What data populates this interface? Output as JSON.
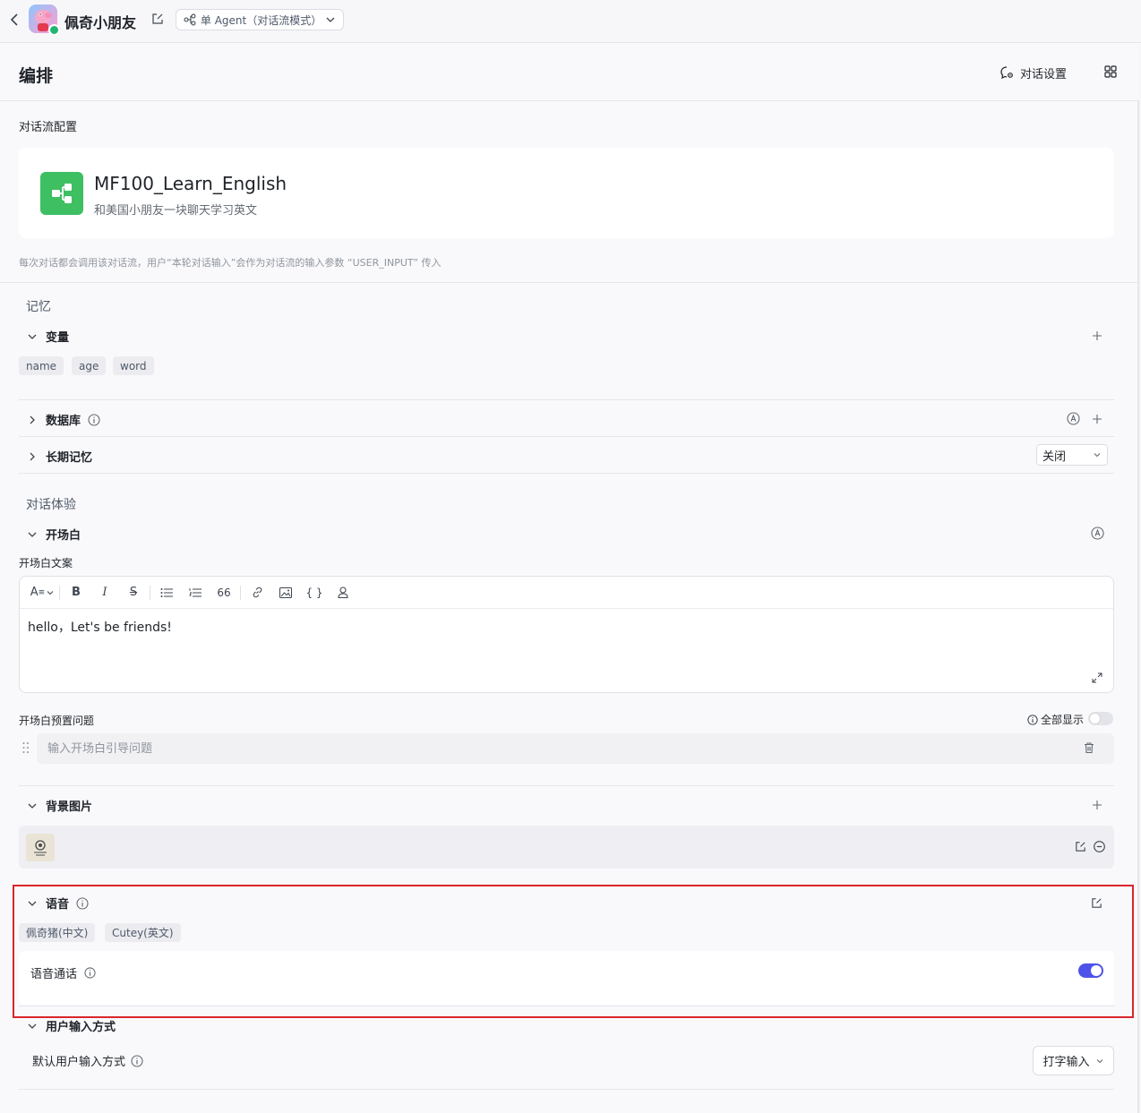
{
  "topbar": {
    "bot_name": "佩奇小朋友",
    "mode": "单 Agent（对话流模式）"
  },
  "header": {
    "title": "编排",
    "dialog_settings": "对话设置"
  },
  "flow": {
    "section_label": "对话流配置",
    "name": "MF100_Learn_English",
    "description": "和美国小朋友一块聊天学习英文",
    "note": "每次对话都会调用该对话流，用户“本轮对话输入”会作为对话流的输入参数 “USER_INPUT” 传入"
  },
  "memory": {
    "group_title": "记忆",
    "variables": {
      "title": "变量",
      "items": [
        "name",
        "age",
        "word"
      ]
    },
    "database": {
      "title": "数据库"
    },
    "long_term": {
      "title": "长期记忆",
      "value": "关闭"
    }
  },
  "experience": {
    "group_title": "对话体验",
    "opening": {
      "title": "开场白",
      "copy_label": "开场白文案",
      "content": "hello，Let's be friends!",
      "preset_label": "开场白预置问题",
      "show_all": "全部显示",
      "preset_placeholder": "输入开场白引导问题"
    },
    "background": {
      "title": "背景图片"
    },
    "voice": {
      "title": "语音",
      "voices": [
        "佩奇猪(中文)",
        "Cutey(英文)"
      ],
      "call_label": "语音通话",
      "call_enabled": true
    },
    "user_input": {
      "title": "用户输入方式",
      "default_label": "默认用户输入方式",
      "value": "打字输入"
    }
  },
  "colors": {
    "accent": "#4d53e8",
    "flow_icon": "#3dbf62",
    "highlight_border": "#d9262c"
  }
}
